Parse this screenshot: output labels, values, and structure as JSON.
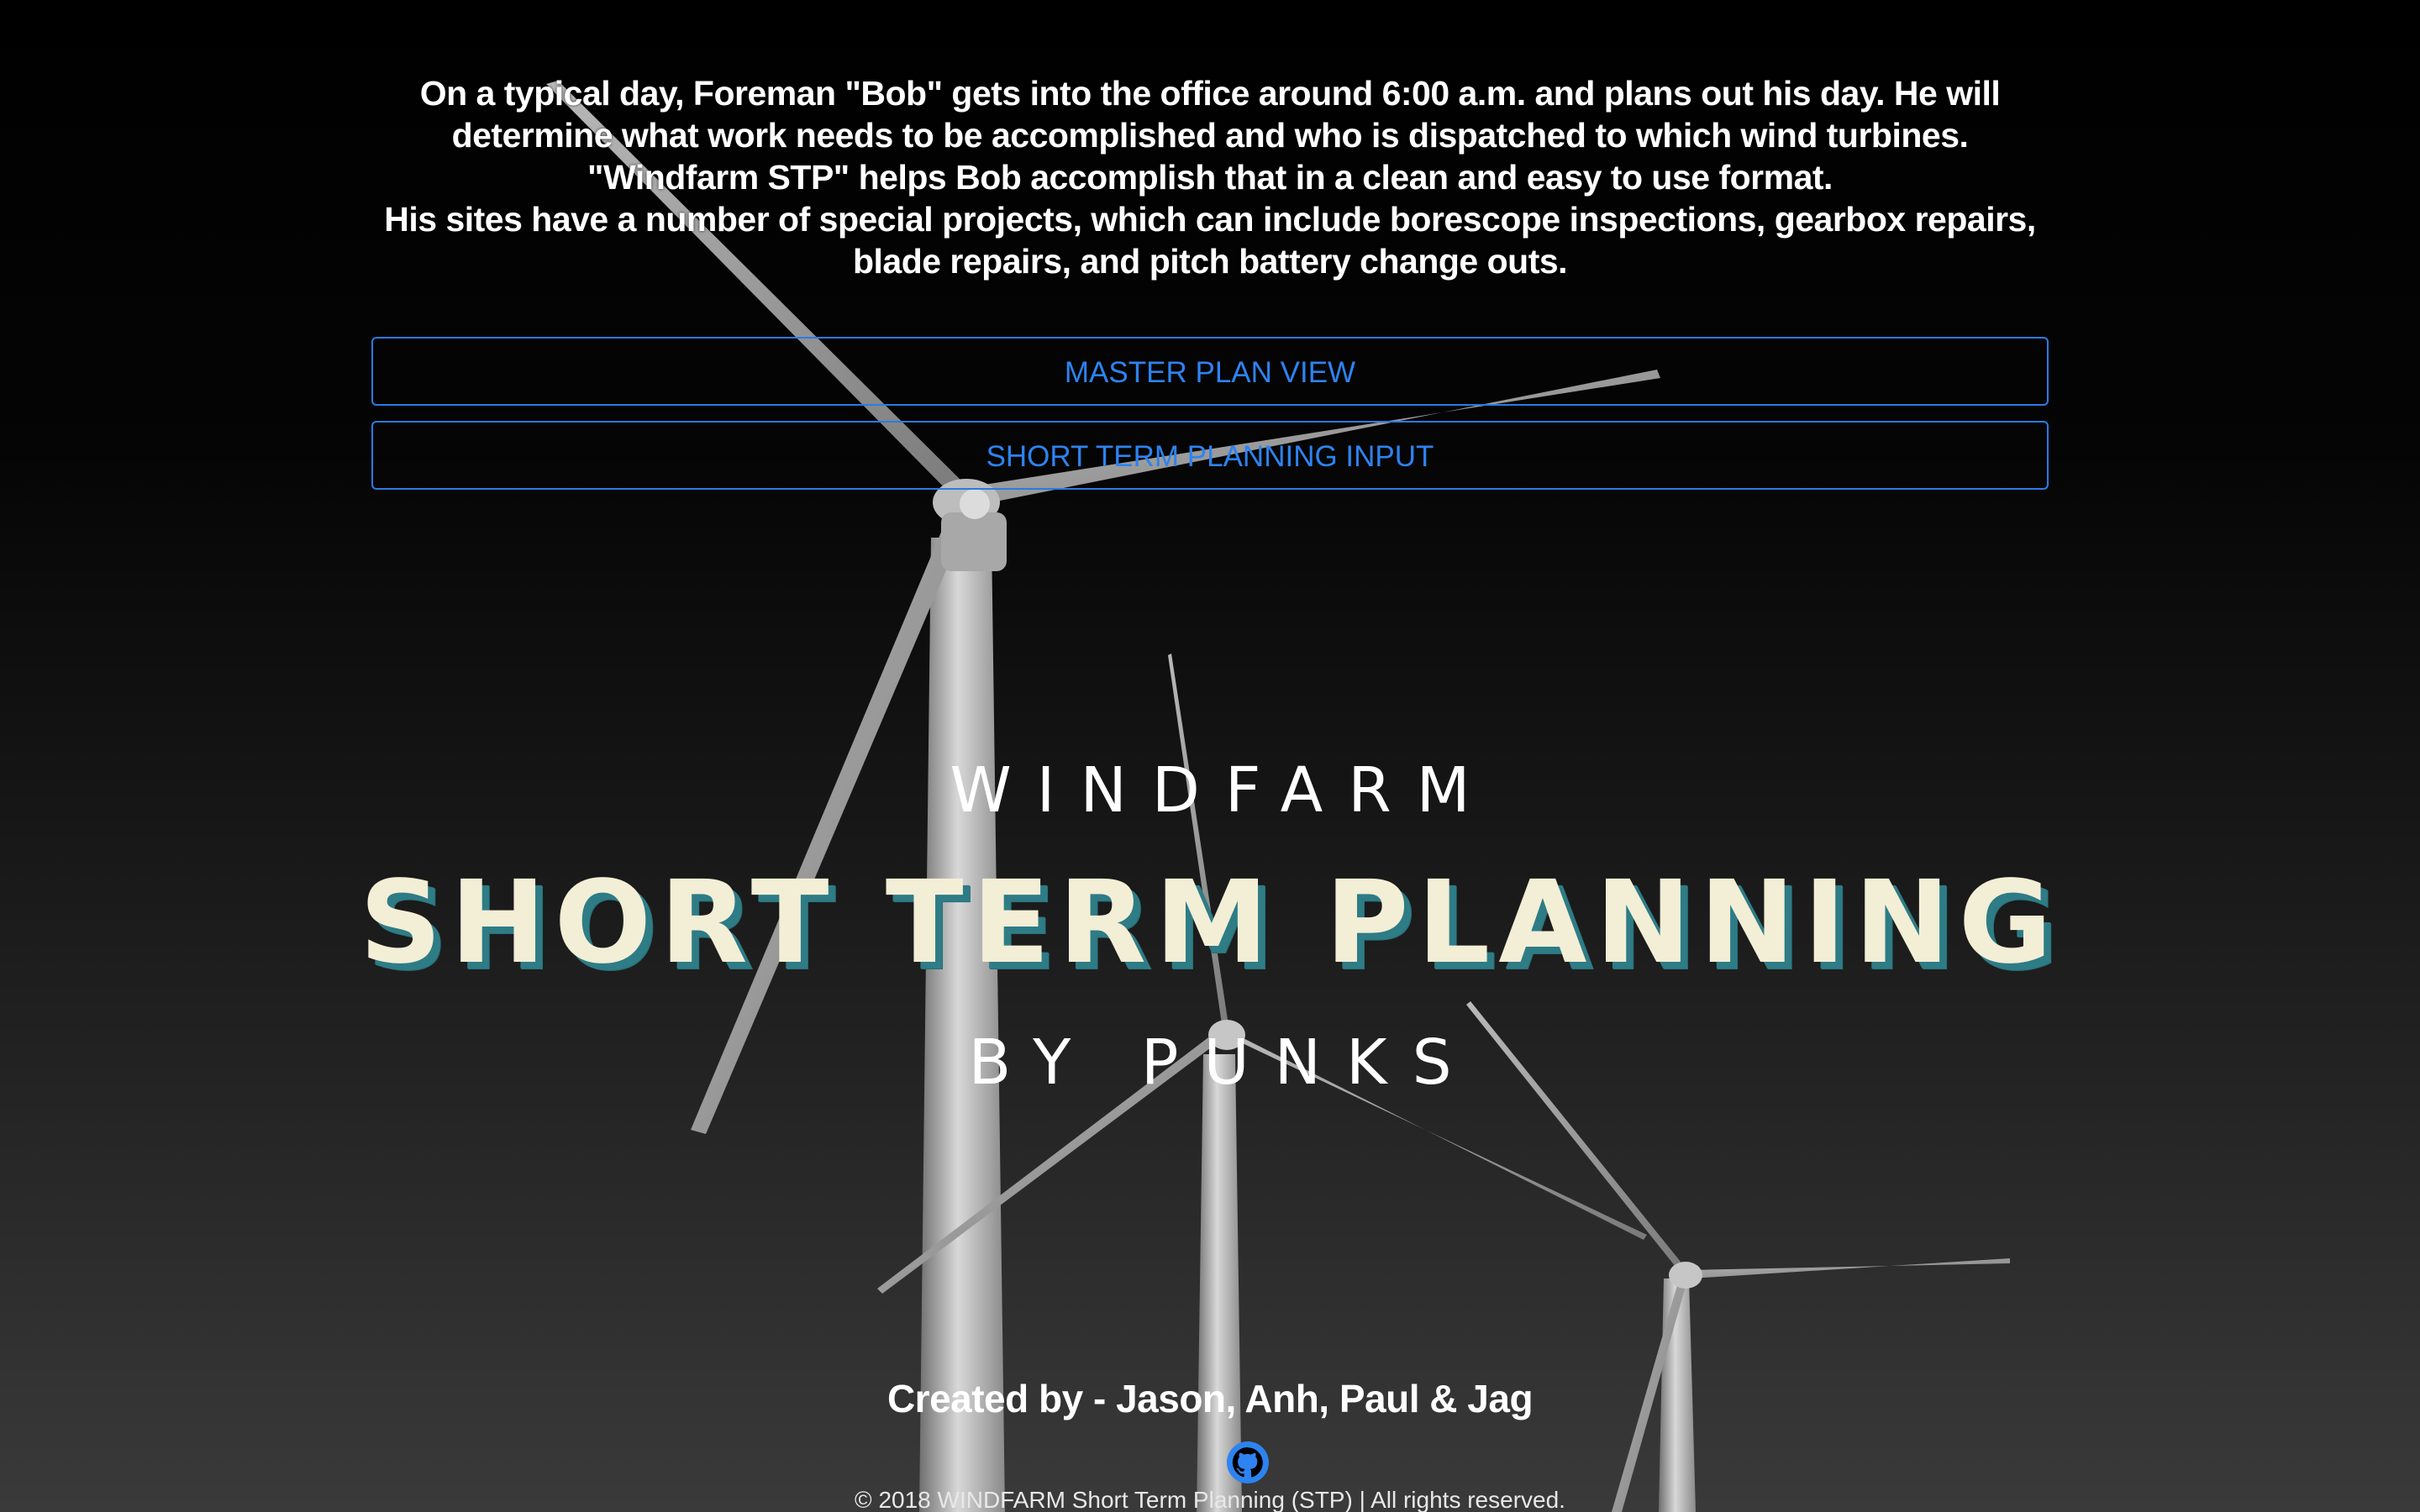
{
  "intro": {
    "line1": "On a typical day, Foreman \"Bob\" gets into the office around 6:00 a.m. and plans out his day. He will",
    "line2": "determine what work needs to be accomplished and who is dispatched to which wind turbines.",
    "line3": "\"Windfarm STP\" helps Bob accomplish that in a clean and easy to use format.",
    "line4": "His sites have a number of special projects, which can include borescope inspections, gearbox repairs,",
    "line5": "blade repairs, and pitch battery change outs."
  },
  "nav": {
    "master_plan_label": "MASTER PLAN VIEW",
    "stp_input_label": "SHORT TERM PLANNING INPUT"
  },
  "hero": {
    "top": "WINDFARM",
    "main": "SHORT TERM PLANNING",
    "bottom": "BY PUNKS"
  },
  "footer": {
    "created_by": "Created by - Jason, Anh, Paul & Jag",
    "github_icon": "github-icon",
    "copyright": "© 2018 WINDFARM Short Term Planning (STP) | All rights reserved."
  },
  "colors": {
    "button_accent": "#2d83f0",
    "title_cream": "#f3eed6",
    "title_shadow": "#2e7c86"
  }
}
